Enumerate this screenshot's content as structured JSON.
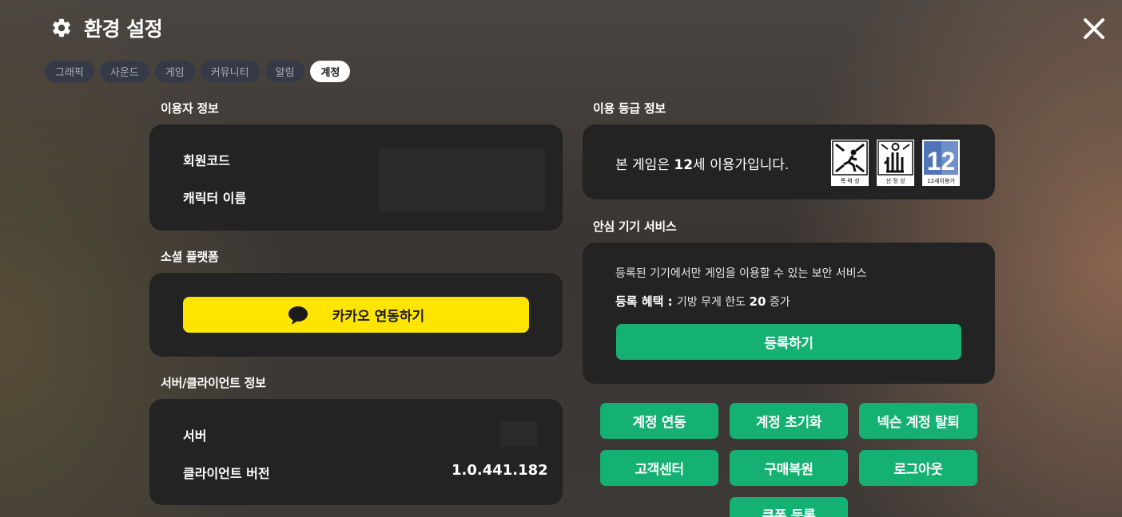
{
  "header": {
    "title": "환경 설정",
    "icon": "gear-icon",
    "close_icon": "close-icon"
  },
  "tabs": [
    {
      "label": "그래픽",
      "active": false
    },
    {
      "label": "사운드",
      "active": false
    },
    {
      "label": "게임",
      "active": false
    },
    {
      "label": "커뮤니티",
      "active": false
    },
    {
      "label": "알림",
      "active": false
    },
    {
      "label": "계정",
      "active": true
    }
  ],
  "user_info": {
    "title": "이용자 정보",
    "member_code_label": "회원코드",
    "character_name_label": "캐릭터 이름"
  },
  "social": {
    "title": "소셜 플랫폼",
    "kakao_label": "카카오 연동하기",
    "kakao_icon": "chat-bubble-icon",
    "kakao_color": "#fee500"
  },
  "server_info": {
    "title": "서버/클라이언트 정보",
    "server_label": "서버",
    "client_version_label": "클라이언트 버전",
    "client_version": "1.0.441.182"
  },
  "rating": {
    "title": "이용 등급 정보",
    "text_prefix": "본 게임은 ",
    "age": "12",
    "text_suffix": "세 이용가입니다.",
    "icons": [
      {
        "name": "violence-icon",
        "caption": "폭 력 성"
      },
      {
        "name": "sensationalism-icon",
        "caption": "선 정 성"
      },
      {
        "name": "age-12-icon",
        "caption": "12세이용가",
        "number": "12"
      }
    ]
  },
  "safe_device": {
    "title": "안심 기기 서비스",
    "description": "등록된 기기에서만 게임을 이용할 수 있는 보안 서비스",
    "benefit_label": "등록 혜택 : ",
    "benefit_text": "기방 무게 한도 ",
    "benefit_value": "20",
    "benefit_suffix": " 증가",
    "register_label": "등록하기"
  },
  "actions": {
    "account_link": "계정 연동",
    "account_reset": "계정 초기화",
    "nexon_withdraw": "넥슨 계정 탈퇴",
    "customer_center": "고객센터",
    "restore_purchase": "구매복원",
    "logout": "로그아웃",
    "coupon_register": "쿠폰 등록"
  },
  "colors": {
    "accent_green": "#14b173",
    "panel": "#232323",
    "tab_inactive": "#353a48"
  }
}
